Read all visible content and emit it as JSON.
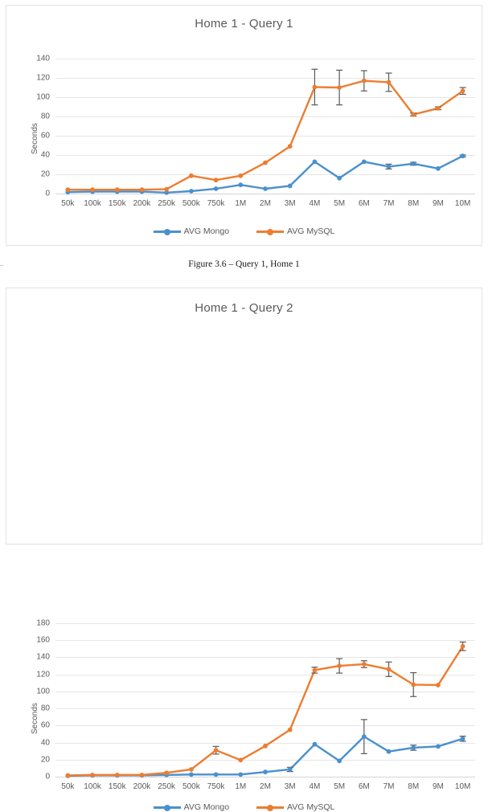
{
  "document": {
    "caption": "Figure 3.6 – Query 1, Home 1"
  },
  "colors": {
    "mongo": "#4A90CE",
    "mysql": "#ED7D31",
    "grid": "#E6E6E6",
    "text": "#5A5A5A",
    "errorbar": "#595959",
    "border": "#E2E2E2"
  },
  "legend": {
    "mongo_label": "AVG Mongo",
    "mysql_label": "AVG MySQL"
  },
  "axis": {
    "ylabel": "Seconds"
  },
  "chart_data": [
    {
      "type": "line",
      "title": "Home 1 - Query 1",
      "xlabel": "",
      "ylabel": "Seconds",
      "ylim": [
        0,
        140
      ],
      "yticks": [
        0,
        20,
        40,
        60,
        80,
        100,
        120,
        140
      ],
      "grid": true,
      "legend_position": "bottom",
      "categories": [
        "50k",
        "100k",
        "150k",
        "200k",
        "250k",
        "500k",
        "750k",
        "1M",
        "2M",
        "3M",
        "4M",
        "5M",
        "6M",
        "7M",
        "8M",
        "9M",
        "10M"
      ],
      "series": [
        {
          "name": "AVG Mongo",
          "color": "#4A90CE",
          "values": [
            1.5,
            2.0,
            2.0,
            2.0,
            1.0,
            2.5,
            5.0,
            9.0,
            5.0,
            8.0,
            33.0,
            16.0,
            33.0,
            28.0,
            31.0,
            26.0,
            39.0
          ],
          "error": [
            0,
            0,
            0,
            0,
            0,
            0,
            0,
            0,
            0,
            0,
            0,
            0,
            0,
            2.5,
            1.5,
            0,
            1.0
          ]
        },
        {
          "name": "AVG MySQL",
          "color": "#ED7D31",
          "values": [
            4.0,
            4.0,
            4.0,
            4.0,
            4.5,
            18.5,
            14.0,
            18.5,
            32.0,
            49.0,
            110.5,
            110.0,
            117.0,
            115.5,
            82.0,
            88.5,
            106.5
          ],
          "error": [
            0,
            0,
            0,
            0,
            0,
            0,
            0,
            0,
            0,
            0,
            18.5,
            18.0,
            10.5,
            9.5,
            1.5,
            1.5,
            3.5
          ]
        }
      ]
    },
    {
      "type": "line",
      "title": "Home 1 - Query 2",
      "xlabel": "",
      "ylabel": "Seconds",
      "ylim": [
        0,
        180
      ],
      "yticks": [
        0,
        20,
        40,
        60,
        80,
        100,
        120,
        140,
        160,
        180
      ],
      "grid": true,
      "legend_position": "bottom",
      "categories": [
        "50k",
        "100k",
        "150k",
        "200k",
        "250k",
        "500k",
        "750k",
        "1M",
        "2M",
        "3M",
        "4M",
        "5M",
        "6M",
        "7M",
        "8M",
        "9M",
        "10M"
      ],
      "series": [
        {
          "name": "AVG Mongo",
          "color": "#4A90CE",
          "values": [
            1.0,
            1.5,
            1.5,
            1.5,
            2.0,
            2.5,
            2.5,
            2.5,
            5.5,
            8.5,
            38.0,
            18.5,
            47.0,
            29.5,
            34.0,
            35.5,
            44.5
          ],
          "error": [
            0,
            0,
            0,
            0,
            0,
            0,
            0,
            0,
            0,
            2.5,
            0,
            0,
            20.0,
            0,
            3.0,
            0,
            3.0
          ]
        },
        {
          "name": "AVG MySQL",
          "color": "#ED7D31",
          "values": [
            1.5,
            2.0,
            2.0,
            2.0,
            4.5,
            8.5,
            31.0,
            19.5,
            36.0,
            55.0,
            125.0,
            130.0,
            132.0,
            126.0,
            108.0,
            107.5,
            153.0
          ],
          "error": [
            0,
            0,
            0,
            0,
            0,
            0,
            4.5,
            0,
            0,
            0,
            3.5,
            8.5,
            4.0,
            8.5,
            14.0,
            0,
            5.0
          ]
        }
      ]
    }
  ]
}
